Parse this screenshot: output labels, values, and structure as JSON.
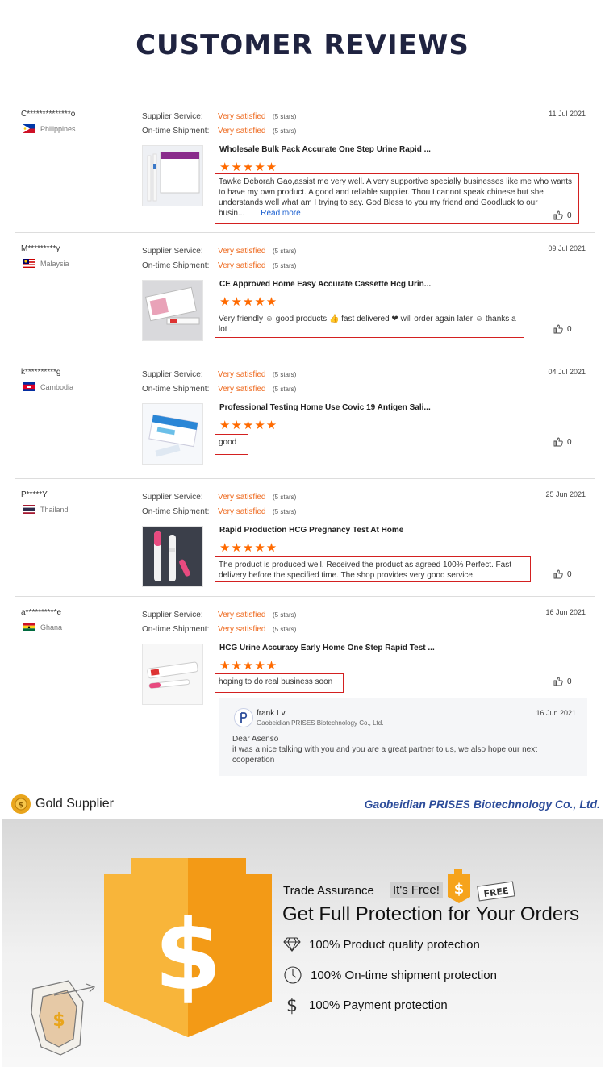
{
  "header": {
    "title": "CUSTOMER REVIEWS"
  },
  "labels": {
    "supplier_service": "Supplier Service:",
    "ontime_shipment": "On-time Shipment:"
  },
  "reviews": [
    {
      "reviewer": "C**************o",
      "country": "Philippines",
      "date": "11 Jul 2021",
      "supplier_rating": "Very satisfied",
      "supplier_stars": "(5 stars)",
      "shipment_rating": "Very satisfied",
      "shipment_stars": "(5 stars)",
      "product": "Wholesale Bulk Pack Accurate One Step Urine Rapid ...",
      "stars": "★★★★★",
      "comment": "Tawke Deborah Gao,assist me very well. A very supportive specially businesses like me who wants to have my own product. A good and reliable supplier. Thou I cannot speak chinese but she understands well what am I trying to say. God Bless to you my friend and Goodluck to our busin...",
      "read_more": "Read more",
      "likes": "0"
    },
    {
      "reviewer": "M*********y",
      "country": "Malaysia",
      "date": "09 Jul 2021",
      "supplier_rating": "Very satisfied",
      "supplier_stars": "(5 stars)",
      "shipment_rating": "Very satisfied",
      "shipment_stars": "(5 stars)",
      "product": "CE Approved Home Easy Accurate Cassette Hcg Urin...",
      "stars": "★★★★★",
      "comment": "Very friendly ☺ good products 👍 fast delivered ❤ will order again later ☺ thanks a lot .",
      "likes": "0"
    },
    {
      "reviewer": "k**********g",
      "country": "Cambodia",
      "date": "04 Jul 2021",
      "supplier_rating": "Very satisfied",
      "supplier_stars": "(5 stars)",
      "shipment_rating": "Very satisfied",
      "shipment_stars": "(5 stars)",
      "product": "Professional Testing Home Use Covic 19 Antigen Sali...",
      "stars": "★★★★★",
      "comment": "good",
      "likes": "0"
    },
    {
      "reviewer": "P*****Y",
      "country": "Thailand",
      "date": "25 Jun 2021",
      "supplier_rating": "Very satisfied",
      "supplier_stars": "(5 stars)",
      "shipment_rating": "Very satisfied",
      "shipment_stars": "(5 stars)",
      "product": "Rapid Production HCG Pregnancy Test At Home",
      "stars": "★★★★★",
      "comment": "The product is produced well.  Received the product as agreed 100%  Perfect. Fast delivery before the specified time.  The shop provides very good service.",
      "likes": "0"
    },
    {
      "reviewer": "a**********e",
      "country": "Ghana",
      "date": "16 Jun 2021",
      "supplier_rating": "Very satisfied",
      "supplier_stars": "(5 stars)",
      "shipment_rating": "Very satisfied",
      "shipment_stars": "(5 stars)",
      "product": "HCG Urine Accuracy Early Home One Step Rapid Test ...",
      "stars": "★★★★★",
      "comment": "hoping to do real business soon",
      "likes": "0"
    }
  ],
  "reply": {
    "name": "frank Lv",
    "company": "Gaobeidian PRISES Biotechnology Co., Ltd.",
    "date": "16 Jun 2021",
    "greeting": "Dear Asenso",
    "body": "it was a nice talking with you and you are a great partner to us, we also hope our next cooperation"
  },
  "footer": {
    "gold_supplier": "Gold Supplier",
    "company_name": "Gaobeidian PRISES Biotechnology Co., Ltd."
  },
  "trade_assurance": {
    "title": "Trade Assurance",
    "free_badge": "It's Free!",
    "stamp": "FREE",
    "headline": "Get Full Protection for Your Orders",
    "items": [
      "100% Product quality protection",
      "100% On-time shipment protection",
      "100% Payment protection"
    ]
  },
  "colors": {
    "accent": "#ff6a00",
    "highlight_border": "#d32020",
    "company_blue": "#2c4c9a"
  },
  "icons": [
    "thumbs-up-icon",
    "diamond-icon",
    "clock-icon",
    "dollar-icon",
    "gold-medal-icon",
    "shield-icon"
  ]
}
